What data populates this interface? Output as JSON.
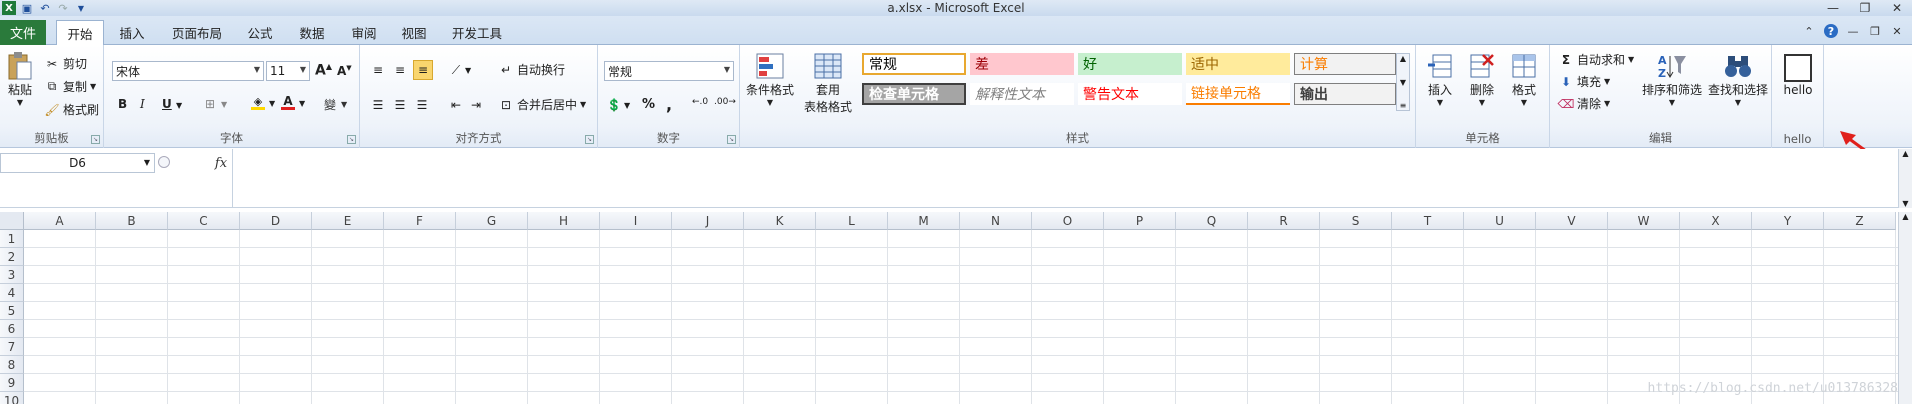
{
  "window": {
    "title": "a.xlsx - Microsoft Excel"
  },
  "tabs": {
    "file": "文件",
    "items": [
      "开始",
      "插入",
      "页面布局",
      "公式",
      "数据",
      "审阅",
      "视图",
      "开发工具"
    ],
    "active": "开始"
  },
  "clipboard": {
    "paste": "粘贴",
    "cut": "剪切",
    "copy": "复制",
    "format_painter": "格式刷",
    "label": "剪贴板"
  },
  "font": {
    "name": "宋体",
    "size": "11",
    "label": "字体",
    "bold": "B",
    "italic": "I",
    "underline": "U",
    "font_color": "#e02020",
    "fill_color": "#ffd800"
  },
  "alignment": {
    "wrap": "自动换行",
    "merge": "合并后居中",
    "label": "对齐方式"
  },
  "number": {
    "format": "常规",
    "percent": "%",
    "comma": ",",
    "label": "数字"
  },
  "styles": {
    "conditional": "条件格式",
    "table_a": "套用",
    "table_b": "表格格式",
    "label": "样式",
    "cells": [
      {
        "text": "常规",
        "fg": "#000000",
        "bg": "#ffffff"
      },
      {
        "text": "差",
        "fg": "#9c0006",
        "bg": "#ffc7ce"
      },
      {
        "text": "好",
        "fg": "#006100",
        "bg": "#c6efce"
      },
      {
        "text": "适中",
        "fg": "#9c6500",
        "bg": "#ffeb9c"
      },
      {
        "text": "计算",
        "fg": "#fa7d00",
        "bg": "#f2f2f2"
      },
      {
        "text": "检查单元格",
        "fg": "#ffffff",
        "bg": "#a5a5a5"
      },
      {
        "text": "解释性文本",
        "fg": "#7f7f7f",
        "bg": "#ffffff"
      },
      {
        "text": "警告文本",
        "fg": "#ff0000",
        "bg": "#ffffff"
      },
      {
        "text": "链接单元格",
        "fg": "#fa7d00",
        "bg": "#ffffff"
      },
      {
        "text": "输出",
        "fg": "#3f3f3f",
        "bg": "#f2f2f2"
      }
    ]
  },
  "cells_group": {
    "insert": "插入",
    "delete": "删除",
    "format": "格式",
    "label": "单元格"
  },
  "editing": {
    "autosum": "自动求和",
    "fill": "填充",
    "clear": "清除",
    "sort_filter": "排序和筛选",
    "find_select": "查找和选择",
    "label": "编辑"
  },
  "custom": {
    "button": "hello",
    "label": "hello"
  },
  "formula_bar": {
    "name_box": "D6",
    "fx": "fx",
    "content": ""
  },
  "grid": {
    "columns": [
      "A",
      "B",
      "C",
      "D",
      "E",
      "F",
      "G",
      "H",
      "I",
      "J",
      "K",
      "L",
      "M",
      "N",
      "O",
      "P",
      "Q",
      "R",
      "S",
      "T",
      "U",
      "V",
      "W",
      "X",
      "Y",
      "Z"
    ],
    "rows": [
      "1",
      "2",
      "3",
      "4",
      "5",
      "6",
      "7",
      "8",
      "9",
      "10"
    ]
  },
  "watermark": "https://blog.csdn.net/u013786328"
}
